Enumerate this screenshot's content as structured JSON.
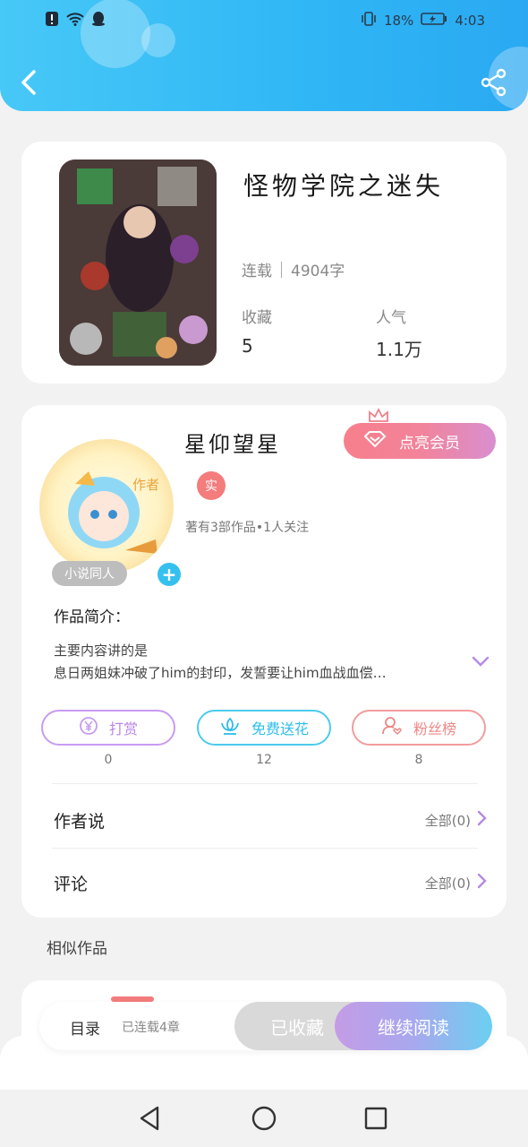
{
  "status_bar": {
    "battery": "18%",
    "time": "4:03"
  },
  "book": {
    "title": "怪物学院之迷失",
    "status": "连载",
    "word_count": "4904字",
    "favorites_label": "收藏",
    "favorites_value": "5",
    "popularity_label": "人气",
    "popularity_value": "1.1万"
  },
  "author": {
    "name": "星仰望星",
    "vip_label": "点亮会员",
    "real_badge": "实",
    "meta": "著有3部作品•1人关注",
    "avatar_tag": "作者"
  },
  "tags": [
    "小说同人"
  ],
  "add_tag": "+",
  "intro": {
    "label": "作品简介：",
    "line1": "主要内容讲的是",
    "line2": "息日两姐妹冲破了him的封印，发誓要让him血战血偿…"
  },
  "actions": [
    {
      "label": "打赏",
      "count": "0",
      "icon": "yen-coin-icon"
    },
    {
      "label": "免费送花",
      "count": "12",
      "icon": "flower-icon"
    },
    {
      "label": "粉丝榜",
      "count": "8",
      "icon": "fans-rank-icon"
    }
  ],
  "author_says": {
    "label": "作者说",
    "right": "全部(0)"
  },
  "comments": {
    "label": "评论",
    "right": "全部(0)"
  },
  "similar": {
    "title": "相似作品"
  },
  "reader_bar": {
    "toc_label": "目录",
    "toc_status": "已连载4章",
    "collected_label": "已收藏",
    "continue_label": "继续阅读"
  },
  "colors": {
    "header": "#2fb6f5",
    "vip": "#f2839a",
    "accent_blue": "#36c0ee",
    "continue_gradient_start": "#c49ce6",
    "continue_gradient_end": "#6ad0f0"
  }
}
